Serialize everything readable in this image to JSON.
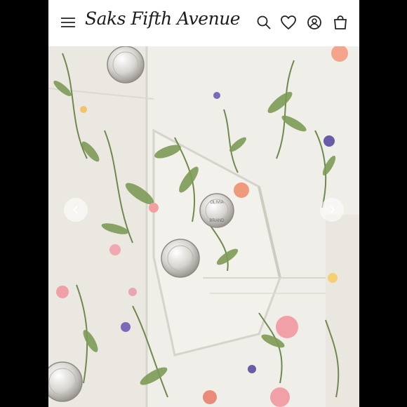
{
  "header": {
    "brand_name": "Saks Fifth Avenue",
    "icons": [
      "menu-icon",
      "search-icon",
      "heart-icon",
      "account-icon",
      "shopping-bag-icon"
    ]
  },
  "product_image": {
    "button_engraving_top": "OLIVIA",
    "button_engraving_bottom": "BRAND"
  },
  "colors": {
    "background": "#000000",
    "header": "#ffffff",
    "fabric": "#efeee8",
    "button_metal": "#d9d7d2"
  }
}
